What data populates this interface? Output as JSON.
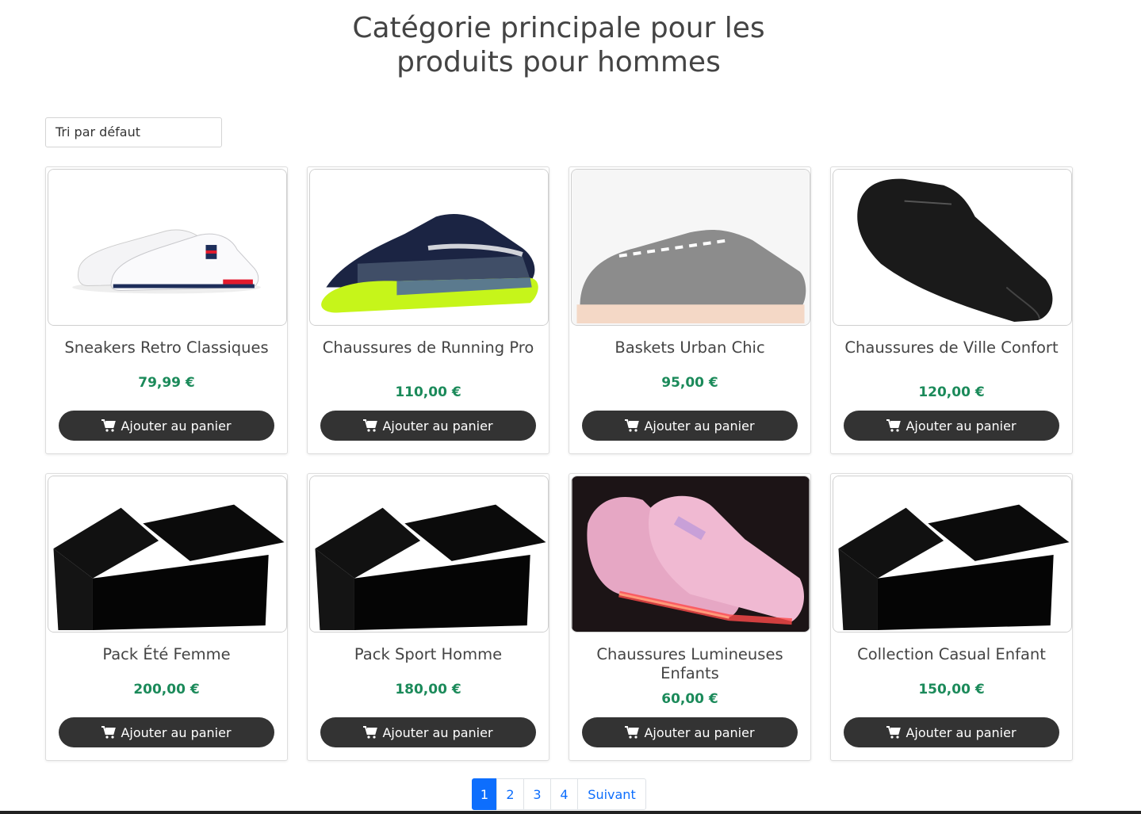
{
  "page": {
    "title_line1": "Catégorie principale pour les",
    "title_line2": "produits pour hommes"
  },
  "sort": {
    "selected": "Tri par défaut"
  },
  "colors": {
    "price": "#1b8a5a",
    "button": "#333333",
    "pager_active": "#0d6efd"
  },
  "products": [
    {
      "title": "Sneakers Retro Classiques",
      "price": "79,99 €",
      "button_label": "Ajouter au panier",
      "image": "white-sneakers"
    },
    {
      "title": "Chaussures de Running Pro",
      "price": "110,00 €",
      "button_label": "Ajouter au panier",
      "image": "running-shoe"
    },
    {
      "title": "Baskets Urban Chic",
      "price": "95,00 €",
      "button_label": "Ajouter au panier",
      "image": "grey-suede-shoe"
    },
    {
      "title": "Chaussures de Ville Confort",
      "price": "120,00 €",
      "button_label": "Ajouter au panier",
      "image": "black-leather-shoe"
    },
    {
      "title": "Pack Été Femme",
      "price": "200,00 €",
      "button_label": "Ajouter au panier",
      "image": "black-box"
    },
    {
      "title": "Pack Sport Homme",
      "price": "180,00 €",
      "button_label": "Ajouter au panier",
      "image": "black-box"
    },
    {
      "title": "Chaussures Lumineuses Enfants",
      "price": "60,00 €",
      "button_label": "Ajouter au panier",
      "image": "pink-led-sneakers"
    },
    {
      "title": "Collection Casual Enfant",
      "price": "150,00 €",
      "button_label": "Ajouter au panier",
      "image": "black-box"
    }
  ],
  "pagination": {
    "pages": [
      "1",
      "2",
      "3",
      "4"
    ],
    "active": "1",
    "next_label": "Suivant"
  }
}
